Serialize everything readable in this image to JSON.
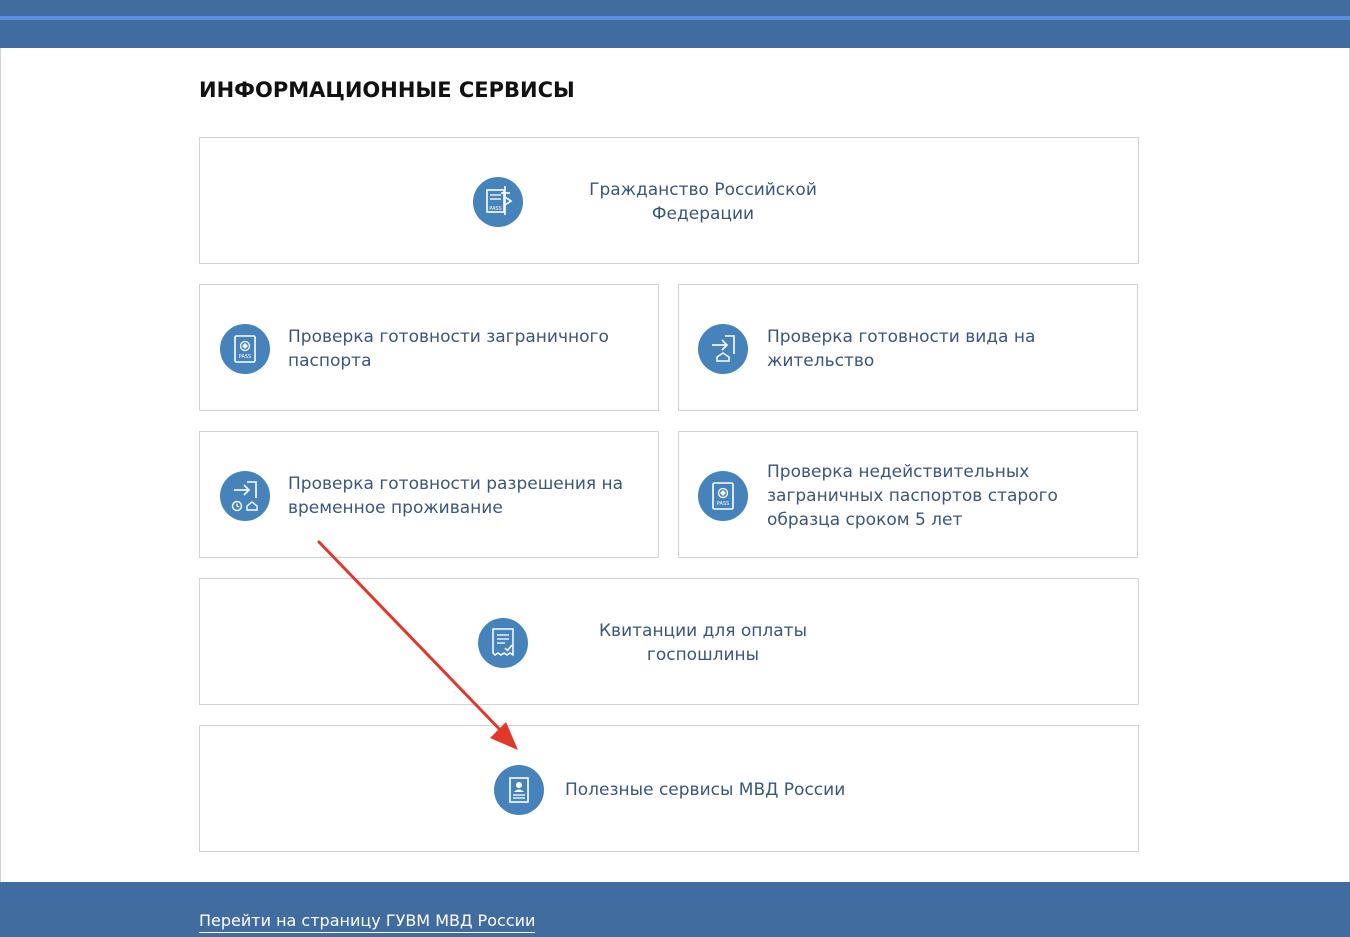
{
  "section": {
    "title": "ИНФОРМАЦИОННЫЕ СЕРВИСЫ"
  },
  "cards": {
    "citizenship": {
      "label_line1": "Гражданство Российской",
      "label_line2": "Федерации",
      "icon": "passport-stamp-icon"
    },
    "foreign_passport": {
      "label_line1": "Проверка готовности заграничного",
      "label_line2": "паспорта",
      "icon": "passport-icon"
    },
    "residence_permit": {
      "label_line1": "Проверка готовности вида на",
      "label_line2": "жительство",
      "icon": "enter-home-icon"
    },
    "temporary_residence": {
      "label_line1": "Проверка готовности разрешения на",
      "label_line2": "временное проживание",
      "icon": "enter-clock-home-icon"
    },
    "invalid_passports": {
      "label_line1": "Проверка недействительных",
      "label_line2": "заграничных паспортов старого",
      "label_line3": "образца сроком 5 лет",
      "icon": "passport-icon"
    },
    "receipts": {
      "label_line1": "Квитанции для оплаты",
      "label_line2": "госпошлины",
      "icon": "receipt-icon"
    },
    "useful_services": {
      "label": "Полезные сервисы МВД России",
      "icon": "document-icon"
    }
  },
  "footer": {
    "link_label": "Перейти на страницу ГУВМ МВД России"
  },
  "colors": {
    "brand_blue": "#416c9f",
    "icon_blue": "#4683bb",
    "text_blue": "#3a5679",
    "annotation_red": "#e0392b"
  }
}
